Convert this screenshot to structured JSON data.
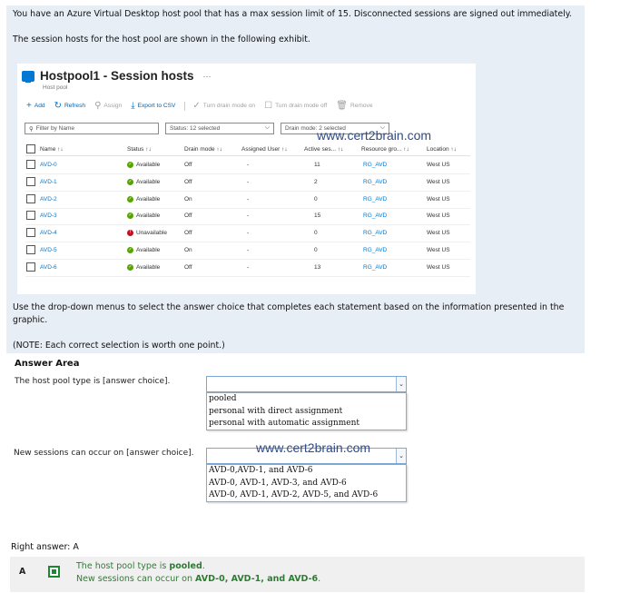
{
  "question": {
    "line1": "You have an Azure Virtual Desktop host pool that has a max session limit of 15. Disconnected sessions are signed out immediately.",
    "line2": "The session hosts for the host pool are shown in the following exhibit.",
    "instruction": "Use the drop-down menus to select the answer choice that completes each statement based on the information presented in the graphic.",
    "note": "(NOTE: Each correct selection is worth one point.)"
  },
  "exhibit": {
    "title": "Hostpool1 - Session hosts",
    "ellipsis": "···",
    "subtitle": "Host pool",
    "toolbar": {
      "add": "Add",
      "refresh": "Refresh",
      "assign": "Assign",
      "export": "Export to CSV",
      "turn_on": "Turn drain mode on",
      "turn_off": "Turn drain mode off",
      "remove": "Remove"
    },
    "filters": {
      "name_placeholder": "Filter by Name",
      "status": "Status: 12 selected",
      "drain": "Drain mode: 2 selected"
    },
    "watermark": "www.cert2brain.com",
    "columns": [
      "Name ↑↓",
      "Status ↑↓",
      "Drain mode ↑↓",
      "Assigned User ↑↓",
      "Active ses... ↑↓",
      "Resource gro... ↑↓",
      "Location ↑↓"
    ],
    "rows": [
      {
        "name": "AVD-0",
        "status": "Available",
        "drain": "Off",
        "user": "-",
        "active": "11",
        "rg": "RG_AVD",
        "location": "West US"
      },
      {
        "name": "AVD-1",
        "status": "Available",
        "drain": "Off",
        "user": "-",
        "active": "2",
        "rg": "RG_AVD",
        "location": "West US"
      },
      {
        "name": "AVD-2",
        "status": "Available",
        "drain": "On",
        "user": "-",
        "active": "0",
        "rg": "RG_AVD",
        "location": "West US"
      },
      {
        "name": "AVD-3",
        "status": "Available",
        "drain": "Off",
        "user": "-",
        "active": "15",
        "rg": "RG_AVD",
        "location": "West US"
      },
      {
        "name": "AVD-4",
        "status": "Unavailable",
        "drain": "Off",
        "user": "-",
        "active": "0",
        "rg": "RG_AVD",
        "location": "West US"
      },
      {
        "name": "AVD-5",
        "status": "Available",
        "drain": "On",
        "user": "-",
        "active": "0",
        "rg": "RG_AVD",
        "location": "West US"
      },
      {
        "name": "AVD-6",
        "status": "Available",
        "drain": "Off",
        "user": "-",
        "active": "13",
        "rg": "RG_AVD",
        "location": "West US"
      }
    ]
  },
  "answer_area": {
    "title": "Answer Area",
    "watermark": "www.cert2brain.com",
    "statement1": "The host pool type is [answer choice].",
    "options1": [
      "pooled",
      "personal with direct assignment",
      "personal with automatic assignment"
    ],
    "statement2": "New sessions can occur on [answer choice].",
    "options2": [
      "AVD-0,AVD-1, and AVD-6",
      "AVD-0, AVD-1, AVD-3, and AVD-6",
      "AVD-0, AVD-1, AVD-2, AVD-5, and AVD-6"
    ]
  },
  "answer": {
    "label": "Right answer: A",
    "letter": "A",
    "line1_prefix": "The host pool type is ",
    "line1_value": "pooled",
    "line1_suffix": ".",
    "line2_prefix": "New sessions can occur on ",
    "line2_value": "AVD-0, AVD-1, and AVD-6",
    "line2_suffix": "."
  },
  "colors": {
    "azure_blue": "#0078d4",
    "available_green": "#57a300",
    "unavailable_red": "#c50f1f",
    "answer_green": "#2e7d32"
  }
}
